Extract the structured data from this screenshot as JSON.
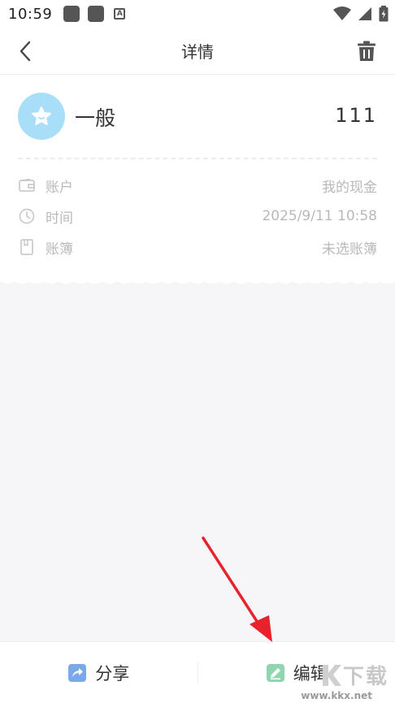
{
  "status_bar": {
    "time": "10:59"
  },
  "nav": {
    "title": "详情"
  },
  "record": {
    "category": "一般",
    "amount": "111",
    "rows": [
      {
        "label": "账户",
        "value": "我的现金",
        "icon": "wallet-icon"
      },
      {
        "label": "时间",
        "value": "2025/9/11  10:58",
        "icon": "clock-icon"
      },
      {
        "label": "账簿",
        "value": "未选账簿",
        "icon": "book-icon"
      }
    ]
  },
  "bottom": {
    "share_label": "分享",
    "edit_label": "编辑"
  },
  "watermark": {
    "text": "下载",
    "url": "www.kkx.net"
  },
  "colors": {
    "category_icon_bg": "#a8def7",
    "share_icon": "#7aa9e8",
    "edit_icon": "#8fd5b0",
    "arrow": "#e8222a"
  }
}
